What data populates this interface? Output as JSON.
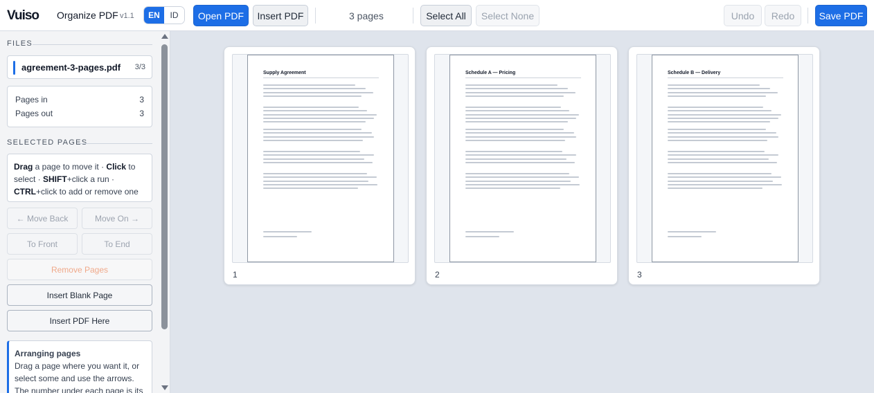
{
  "app": {
    "title": "Organize PDF",
    "version": "v1.1",
    "lang_active": "EN",
    "lang_other": "ID"
  },
  "toolbar": {
    "open_pdf": "Open PDF",
    "insert_pdf": "Insert PDF",
    "pages_count": "3 pages",
    "select_all": "Select All",
    "select_none": "Select None",
    "undo": "Undo",
    "redo": "Redo",
    "save_pdf": "Save PDF"
  },
  "sidebar": {
    "files_title": "FILES",
    "file": {
      "name": "agreement-3-pages.pdf",
      "count": "3/3"
    },
    "stats": [
      {
        "label": "Pages in",
        "value": "3"
      },
      {
        "label": "Pages out",
        "value": "3"
      }
    ],
    "selected_title": "SELECTED PAGES",
    "help": {
      "drag": "Drag",
      "t1": " a page to move it · ",
      "click": "Click",
      "t2": " to select · ",
      "shift": "SHIFT",
      "t3": "+click a run · ",
      "ctrl": "CTRL",
      "t4": "+click to add or remove one"
    },
    "move_back": "← Move Back",
    "move_on": "Move On →",
    "to_front": "To Front",
    "to_end": "To End",
    "remove_pages": "Remove Pages",
    "insert_blank": "Insert Blank Page",
    "insert_pdf_here": "Insert PDF Here",
    "info_title": "Arranging pages",
    "info_text": "Drag a page where you want it, or select some and use the arrows. The number under each page is its place"
  },
  "pages": [
    {
      "number": "1",
      "heading": "Supply Agreement"
    },
    {
      "number": "2",
      "heading": "Schedule A — Pricing"
    },
    {
      "number": "3",
      "heading": "Schedule B — Delivery"
    }
  ],
  "colors": {
    "accent": "#1d6ee6",
    "canvas": "#dfe4ec"
  }
}
